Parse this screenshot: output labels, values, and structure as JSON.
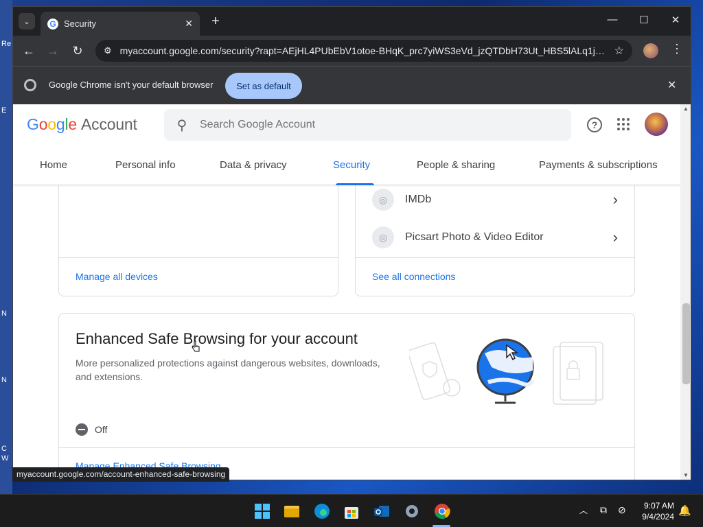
{
  "desktop": {
    "edge_labels": [
      "Re",
      "E",
      "N",
      "N",
      "C",
      "W"
    ]
  },
  "browser": {
    "tab_title": "Security",
    "tab_favicon": "G",
    "url": "myaccount.google.com/security?rapt=AEjHL4PUbEbV1otoe-BHqK_prc7yiWS3eVd_jzQTDbH73Ut_HBS5lALq1jCkl...",
    "infobar_text": "Google Chrome isn't your default browser",
    "set_default_label": "Set as default",
    "status_url": "myaccount.google.com/account-enhanced-safe-browsing"
  },
  "account": {
    "logo_letters": [
      "G",
      "o",
      "o",
      "g",
      "l",
      "e"
    ],
    "logo_suffix": "Account",
    "search_placeholder": "Search Google Account",
    "nav": [
      "Home",
      "Personal info",
      "Data & privacy",
      "Security",
      "People & sharing",
      "Payments & subscriptions"
    ],
    "active_nav": "Security"
  },
  "devices_card": {
    "link": "Manage all devices"
  },
  "connections_card": {
    "items": [
      {
        "label": "IMDb"
      },
      {
        "label": "Picsart Photo & Video Editor"
      }
    ],
    "link": "See all connections"
  },
  "esb_card": {
    "title": "Enhanced Safe Browsing for your account",
    "description": "More personalized protections against dangerous websites, downloads, and extensions.",
    "status": "Off",
    "link": "Manage Enhanced Safe Browsing"
  },
  "taskbar": {
    "time": "9:07 AM",
    "date": "9/4/2024"
  },
  "colors": {
    "accent_blue": "#1a73e8",
    "infobar_button": "#a8c7fa",
    "chrome_dark": "#35363a"
  }
}
